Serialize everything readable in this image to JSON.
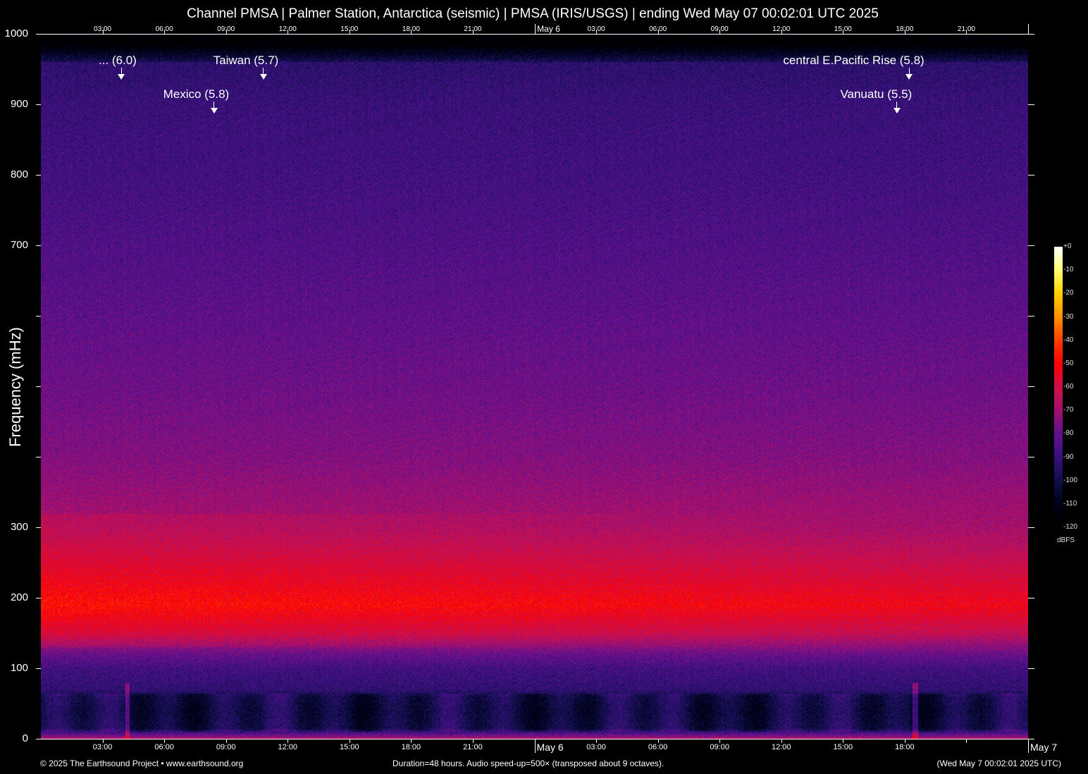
{
  "chart_data": {
    "type": "heatmap",
    "title": "Channel PMSA | Palmer Station, Antarctica (seismic) | PMSA (IRIS/USGS) | ending Wed May 07 00:02:01 UTC 2025",
    "ylabel": "Frequency (mHz)",
    "xlabel": "",
    "ylim": [
      0,
      1000
    ],
    "xlim_hours": [
      0,
      48
    ],
    "y_ticks": [
      0,
      100,
      200,
      300,
      400,
      500,
      600,
      700,
      800,
      900,
      1000
    ],
    "y_tick_labels": [
      "0",
      "100",
      "200",
      "300",
      "",
      "",
      "",
      "700",
      "800",
      "900",
      "1000"
    ],
    "x_ticks_hours": [
      3,
      6,
      9,
      12,
      15,
      18,
      21,
      24,
      27,
      30,
      33,
      36,
      39,
      42,
      45,
      48
    ],
    "bottom_tick_labels": [
      "03:00",
      "06:00",
      "09:00",
      "12:00",
      "15:00",
      "18:00",
      "21:00",
      "May  6",
      "03:00",
      "06:00",
      "09:00",
      "12:00",
      "15:00",
      "18:00",
      "",
      "May  7"
    ],
    "top_tick_labels": [
      "03:00",
      "06:00",
      "09:00",
      "12:00",
      "15:00",
      "18:00",
      "21:00",
      "May  6",
      "03:00",
      "06:00",
      "09:00",
      "12:00",
      "15:00",
      "18:00",
      "21:00",
      ""
    ],
    "colorbar": {
      "label": "dBFS",
      "range": [
        -120,
        0
      ],
      "tick_labels": [
        "+0",
        "-10",
        "-20",
        "-30",
        "-40",
        "-50",
        "-60",
        "-70",
        "-80",
        "-90",
        "-100",
        "-110",
        "-120"
      ]
    },
    "colormap": [
      [
        -120,
        "#000000"
      ],
      [
        -110,
        "#00001c"
      ],
      [
        -100,
        "#10104a"
      ],
      [
        -90,
        "#38107e"
      ],
      [
        -80,
        "#66108e"
      ],
      [
        -70,
        "#a01070"
      ],
      [
        -60,
        "#d0104a"
      ],
      [
        -50,
        "#ff0000"
      ],
      [
        -40,
        "#ff4000"
      ],
      [
        -30,
        "#ff9000"
      ],
      [
        -20,
        "#ffd000"
      ],
      [
        -10,
        "#ffff70"
      ],
      [
        0,
        "#ffffff"
      ]
    ],
    "frequency_profile_dbfs": [
      [
        0,
        -65
      ],
      [
        8,
        -85
      ],
      [
        15,
        -100
      ],
      [
        40,
        -102
      ],
      [
        60,
        -100
      ],
      [
        70,
        -92
      ],
      [
        100,
        -88
      ],
      [
        120,
        -80
      ],
      [
        150,
        -62
      ],
      [
        190,
        -52
      ],
      [
        230,
        -58
      ],
      [
        300,
        -68
      ],
      [
        400,
        -75
      ],
      [
        500,
        -79
      ],
      [
        600,
        -82
      ],
      [
        700,
        -85
      ],
      [
        800,
        -88
      ],
      [
        900,
        -90
      ],
      [
        960,
        -93
      ],
      [
        975,
        -106
      ],
      [
        990,
        -120
      ],
      [
        1000,
        -120
      ]
    ],
    "events": [
      {
        "label": "... (6.0)",
        "hour": 3.9,
        "row": 1
      },
      {
        "label": "Taiwan (5.7)",
        "hour": 10.8,
        "row": 1
      },
      {
        "label": "Mexico (5.8)",
        "hour": 8.4,
        "row": 2
      },
      {
        "label": "central E.Pacific Rise (5.8)",
        "hour": 42.2,
        "row": 1
      },
      {
        "label": "Vanuatu (5.5)",
        "hour": 41.6,
        "row": 2
      }
    ]
  },
  "footer": {
    "copyright": "© 2025 The Earthsound Project • www.earthsound.org",
    "info": "Duration=48 hours. Audio speed-up=500× (transposed about 9 octaves).",
    "end_time": "(Wed May  7 00:02:01 2025 UTC)"
  }
}
